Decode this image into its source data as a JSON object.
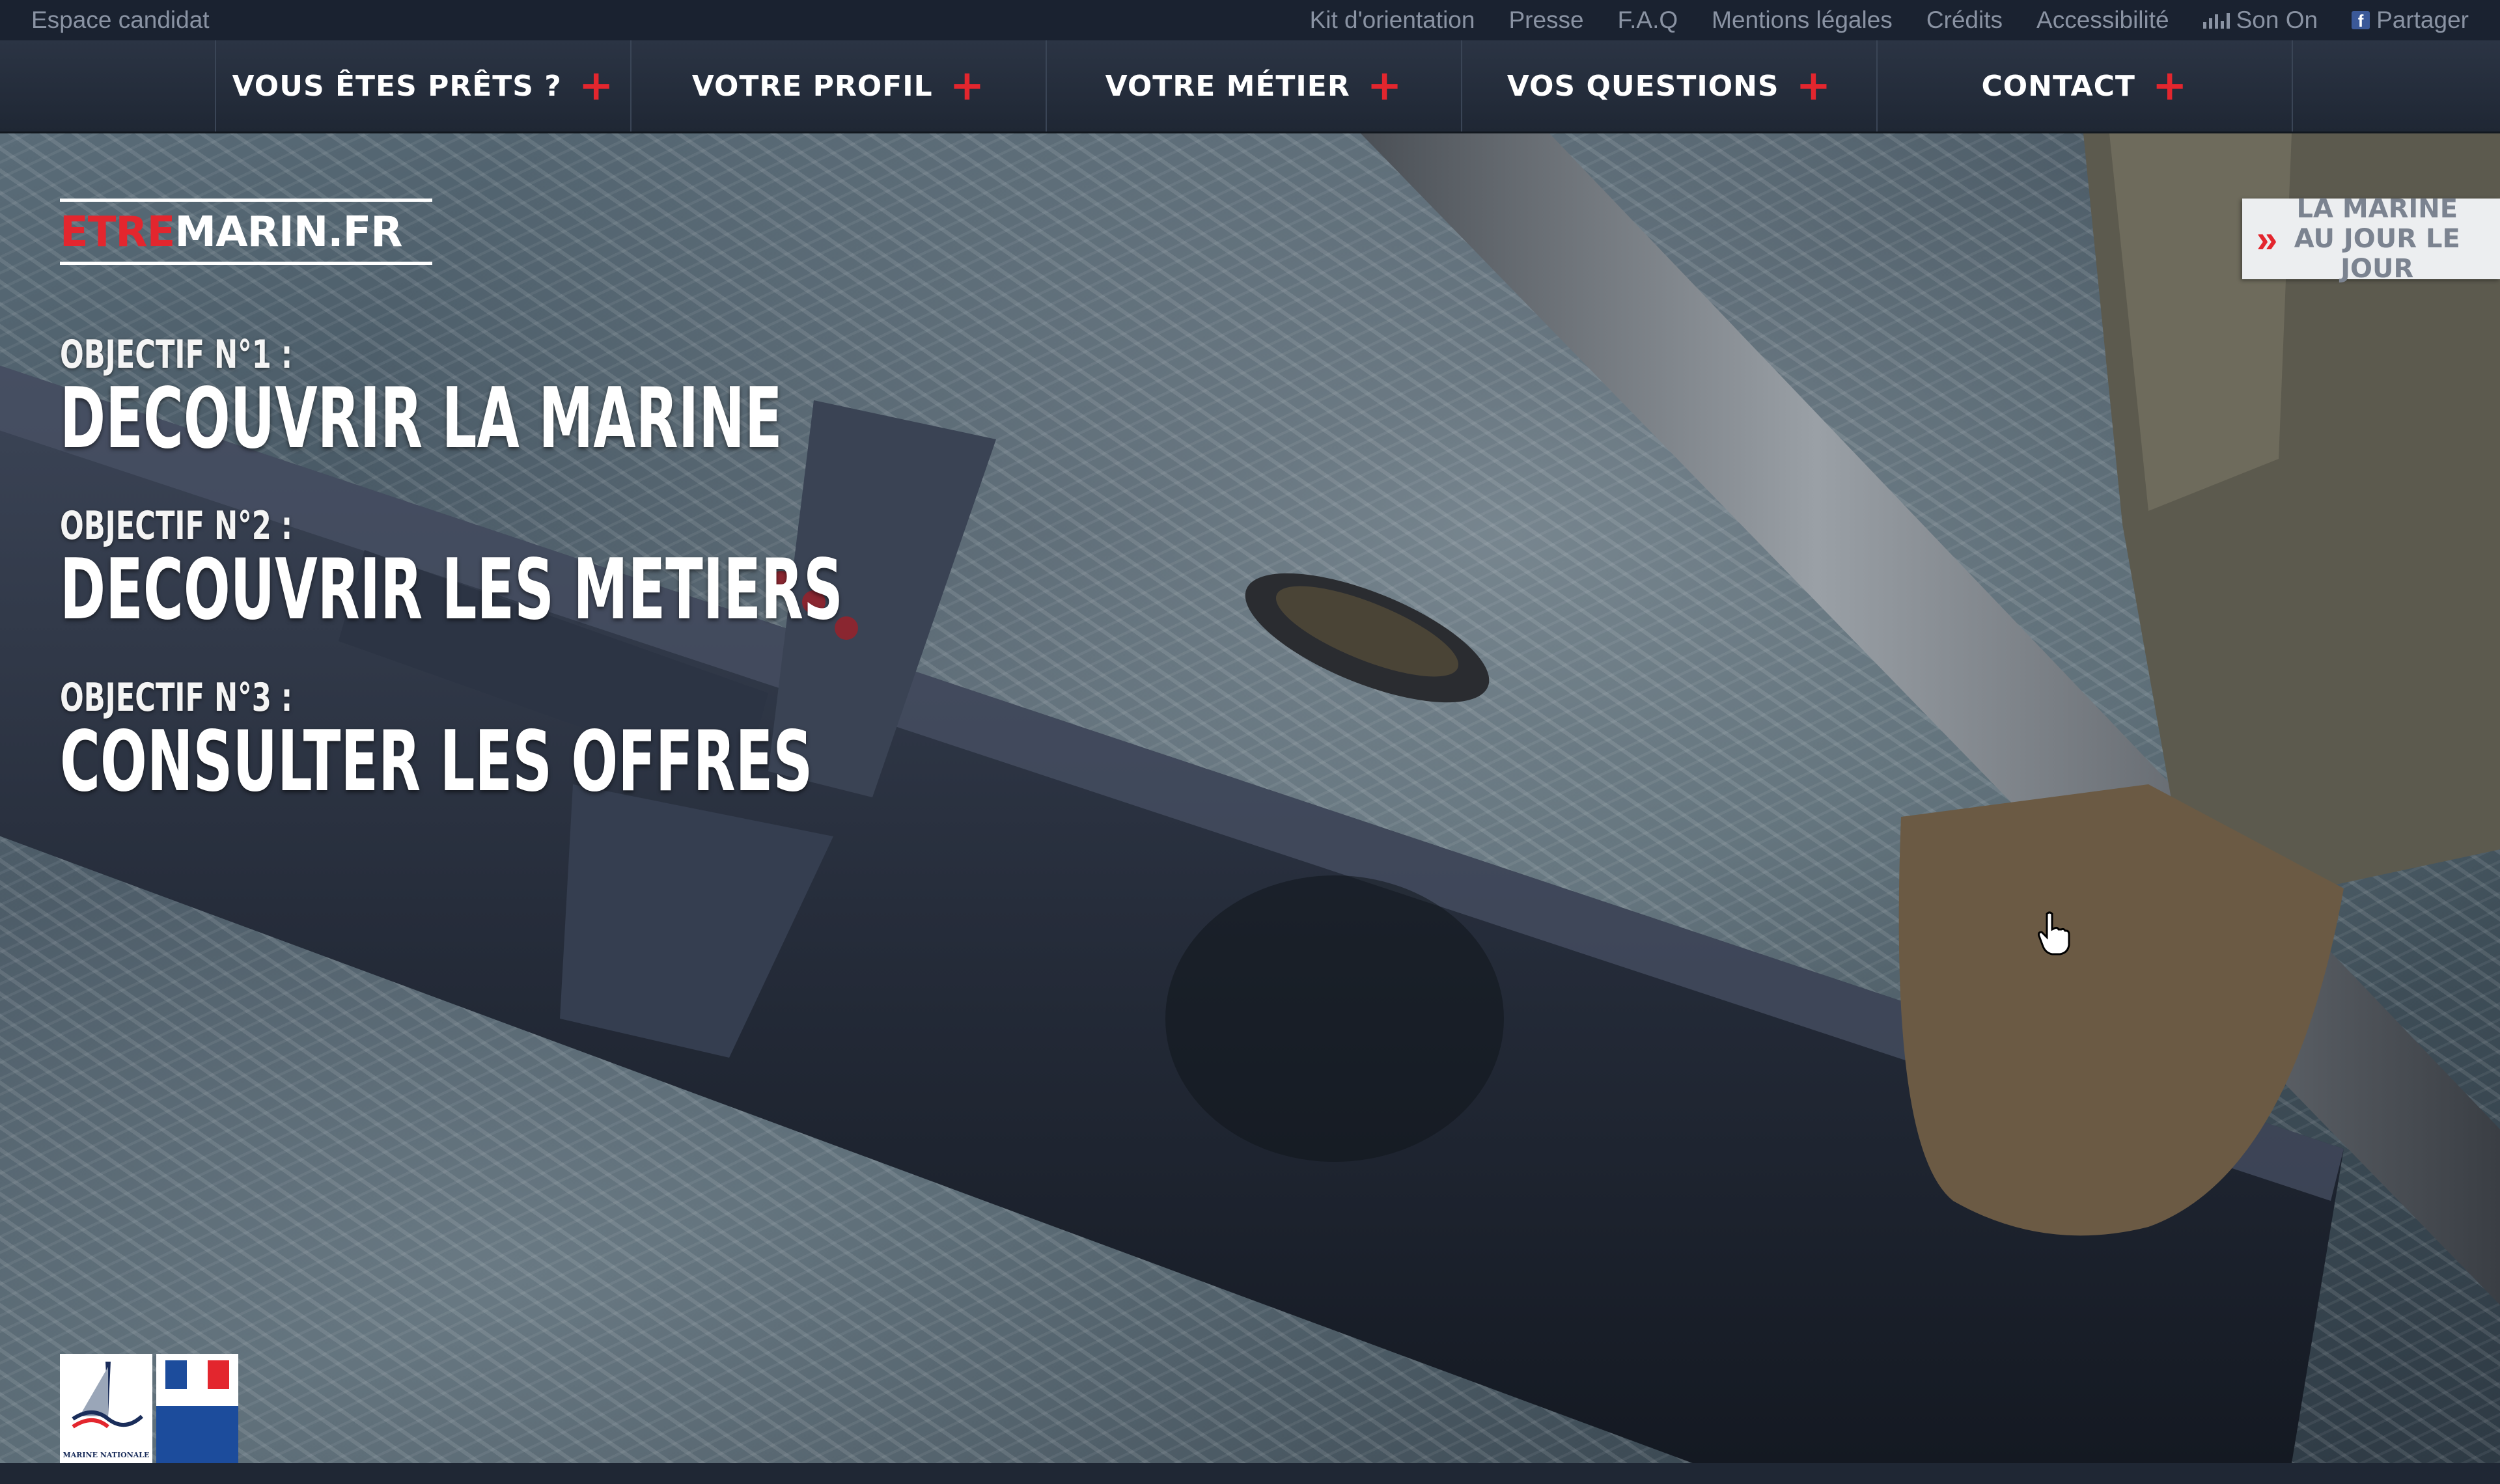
{
  "utility_bar": {
    "left_link": "Espace candidat",
    "links": [
      "Kit d'orientation",
      "Presse",
      "F.A.Q",
      "Mentions légales",
      "Crédits",
      "Accessibilité"
    ],
    "sound_label": "Son On",
    "sound_icon": "sound-bars-icon",
    "share_label": "Partager",
    "share_icon": "facebook-icon"
  },
  "main_nav": {
    "items": [
      {
        "label": "VOUS ÊTES PRÊTS ?"
      },
      {
        "label": "VOTRE PROFIL"
      },
      {
        "label": "VOTRE MÉTIER"
      },
      {
        "label": "VOS QUESTIONS"
      },
      {
        "label": "CONTACT"
      }
    ],
    "plus_symbol": "+"
  },
  "hero": {
    "logo": {
      "part1": "ETRE",
      "part2": "MARIN.FR"
    },
    "objectives": [
      {
        "number_label": "OBJECTIF N°1 :",
        "title": "DECOUVRIR LA MARINE"
      },
      {
        "number_label": "OBJECTIF N°2 :",
        "title": "DECOUVRIR LES METIERS"
      },
      {
        "number_label": "OBJECTIF N°3 :",
        "title": "CONSULTER LES OFFRES"
      }
    ],
    "side_tab": {
      "chevrons": "»",
      "label": "LA MARINE AU JOUR LE JOUR"
    },
    "partners": {
      "marine_caption": "MARINE NATIONALE"
    }
  },
  "colors": {
    "accent_red": "#e3262e",
    "nav_bg": "#2b3444",
    "utility_bg": "#1a2230",
    "utility_text": "#8a93a3"
  }
}
